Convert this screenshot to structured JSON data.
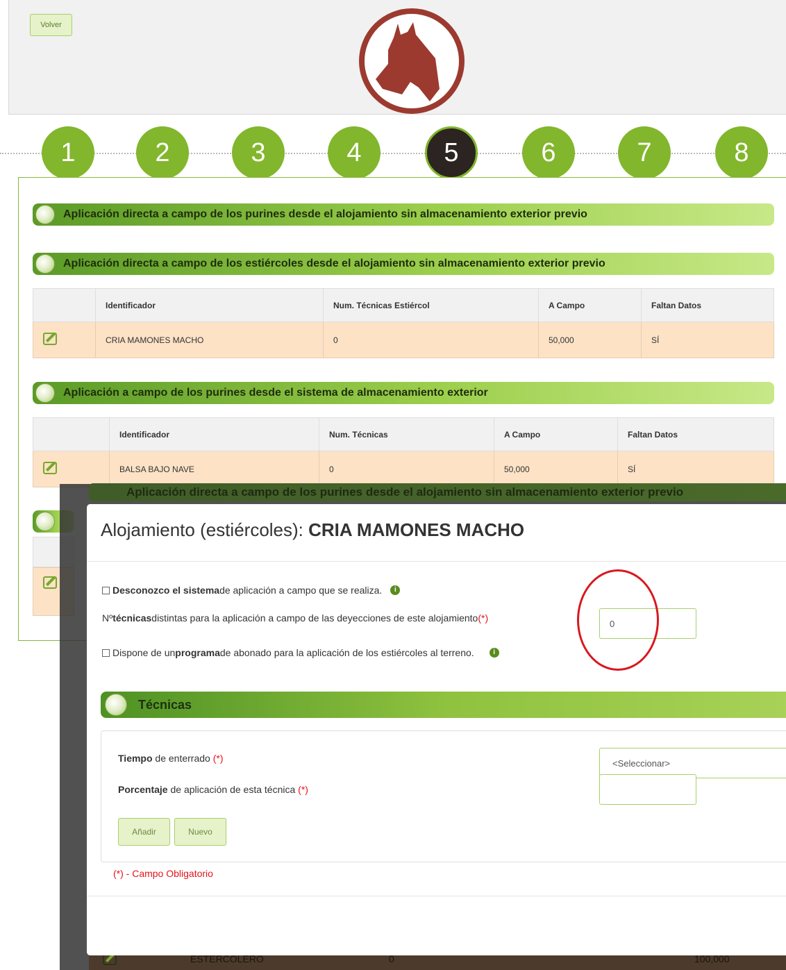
{
  "header": {
    "back_label": "Volver"
  },
  "steps": [
    "1",
    "2",
    "3",
    "4",
    "5",
    "6",
    "7",
    "8"
  ],
  "active_step": "5",
  "sections": {
    "s1": {
      "title": "Aplicación directa a campo de los purines desde el alojamiento sin almacenamiento exterior previo"
    },
    "s2": {
      "title": "Aplicación directa a campo de los estiércoles desde el alojamiento sin almacenamiento exterior previo",
      "columns": [
        "Identificador",
        "Num. Técnicas Estiércol",
        "A Campo",
        "Faltan Datos"
      ],
      "row": [
        "CRIA MAMONES MACHO",
        "0",
        "50,000",
        "SÍ"
      ]
    },
    "s3": {
      "title": "Aplicación a campo de los purines desde el sistema de almacenamiento exterior",
      "columns": [
        "Identificador",
        "Num. Técnicas",
        "A Campo",
        "Faltan Datos"
      ],
      "row": [
        "BALSA BAJO NAVE",
        "0",
        "50,000",
        "SÍ"
      ]
    }
  },
  "background": {
    "bar_title": "Aplicación directa a campo de los purines desde el alojamiento sin almacenamiento exterior previo",
    "row": [
      "ESTERCOLERO",
      "0",
      "100,000"
    ]
  },
  "modal": {
    "title_prefix": "Alojamiento (estiércoles): ",
    "title_name": "CRIA MAMONES MACHO",
    "unknown_bold": "Desconozco el sistema",
    "unknown_rest": " de aplicación a campo que se realiza.",
    "techniques_pre": "Nº ",
    "techniques_bold": "técnicas",
    "techniques_rest": " distintas para la aplicación a campo de las deyecciones de este alojamiento",
    "req_mark": "(*)",
    "techniques_value": "0",
    "program_pre": "Dispone de un ",
    "program_bold": "programa",
    "program_rest": " de abonado para la aplicación de los estiércoles al terreno.",
    "section_title": "Técnicas",
    "time_bold": "Tiempo",
    "time_rest": " de enterrado ",
    "select_value": "<Seleccionar>",
    "pct_bold": "Porcentaje",
    "pct_rest": " de aplicación de esta técnica ",
    "add_label": "Añadir",
    "new_label": "Nuevo",
    "required_note": "(*) - Campo Obligatorio"
  },
  "colors": {
    "brand_green": "#82b62c",
    "logo_brown": "#9c3a2f",
    "active_step": "#2c2420",
    "row_bg": "#fde2c6",
    "required": "#e4141b"
  },
  "icons": [
    "cow-logo",
    "edit-icon",
    "info-icon",
    "leaf-icon"
  ]
}
